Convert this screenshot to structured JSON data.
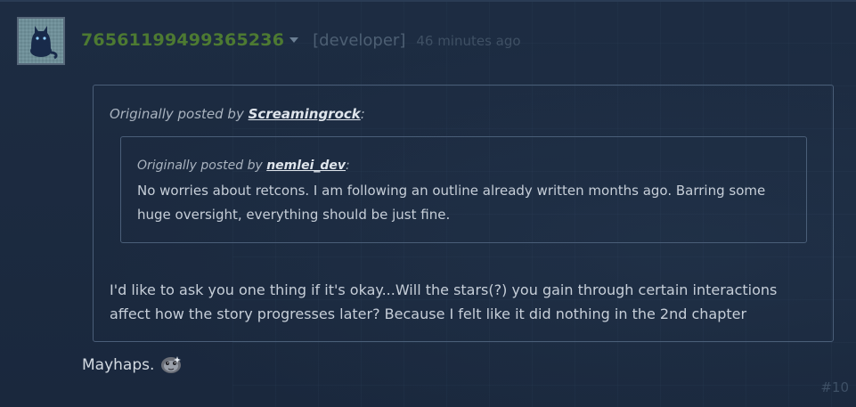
{
  "post": {
    "author": "76561199499365236",
    "role": "[developer]",
    "timestamp": "46 minutes ago",
    "reply_text": "Mayhaps.",
    "post_number": "#10",
    "icons": [
      "avatar-cat",
      "dropdown-caret",
      "emoticon-creature"
    ]
  },
  "quote_outer": {
    "prefix": "Originally posted by",
    "author": "Screamingrock",
    "suffix": ":",
    "text": "I'd like to ask you one thing if it's okay...Will the stars(?) you gain through certain interactions affect how the story progresses later? Because I felt like it did nothing in the 2nd chapter"
  },
  "quote_inner": {
    "prefix": "Originally posted by",
    "author": "nemlei_dev",
    "suffix": ":",
    "text": "No worries about retcons. I am following an outline already written months ago. Barring some huge oversight, everything should be just fine."
  },
  "colors": {
    "background": "#1b2a40",
    "author": "#4d7a32",
    "border": "#4a5e78",
    "body_text": "#c6ced8"
  }
}
